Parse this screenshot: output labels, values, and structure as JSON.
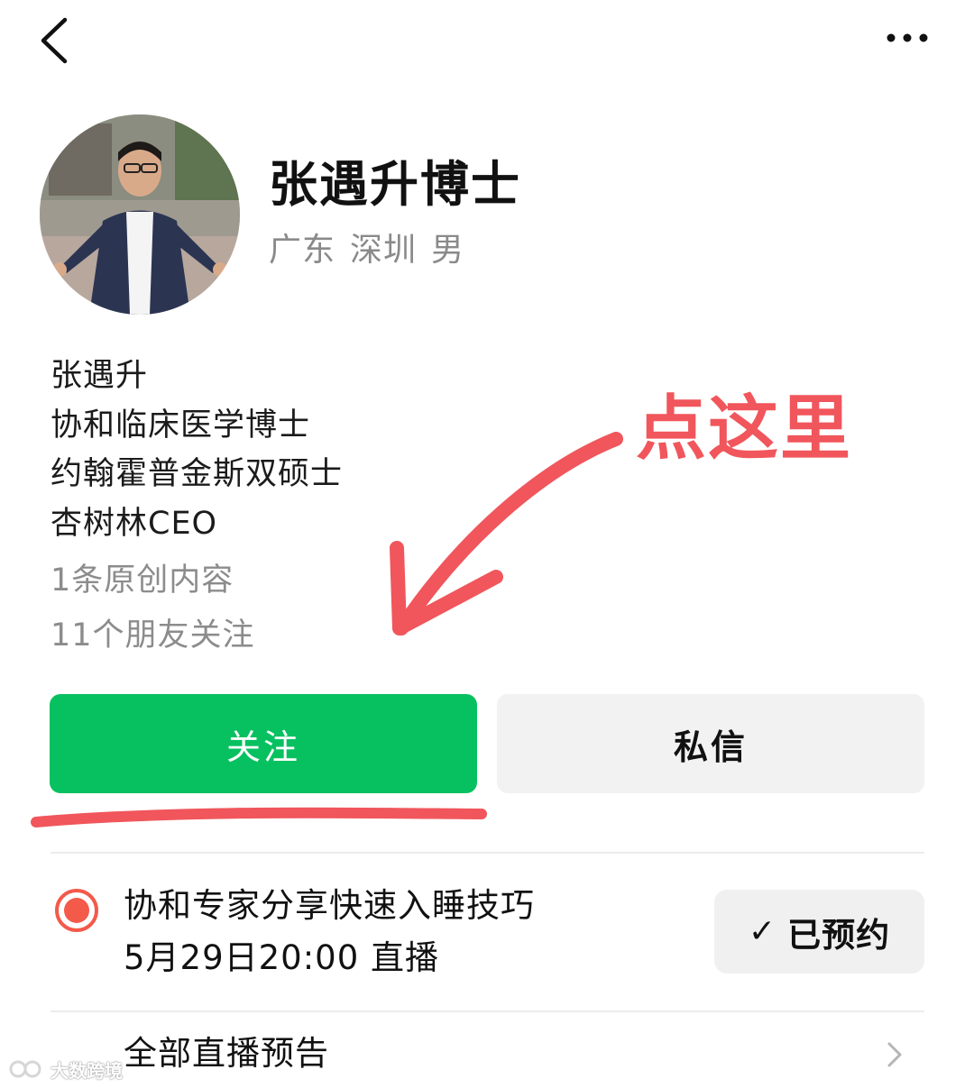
{
  "profile": {
    "name": "张遇升博士",
    "meta": [
      "广东",
      "深圳",
      "男"
    ],
    "bio_lines": [
      "张遇升",
      "协和临床医学博士",
      "约翰霍普金斯双硕士",
      "杏树林CEO"
    ],
    "stats": [
      "1条原创内容",
      "11个朋友关注"
    ]
  },
  "actions": {
    "follow_label": "关注",
    "message_label": "私信"
  },
  "annotation": {
    "text": "点这里",
    "color": "#f0565b"
  },
  "live": {
    "title": "协和专家分享快速入睡技巧",
    "time": "5月29日20:00 直播",
    "reserved_label": "已预约",
    "all_label": "全部直播预告"
  },
  "watermark": {
    "text": "大数跨境"
  },
  "colors": {
    "accent_green": "#07c160",
    "live_red": "#f35a4a",
    "secondary_button": "#f2f2f2"
  },
  "icons": {
    "back": "chevron-left-icon",
    "more": "more-dots-icon",
    "live": "live-dot-icon",
    "check": "check-icon",
    "chevron": "chevron-right-icon"
  }
}
